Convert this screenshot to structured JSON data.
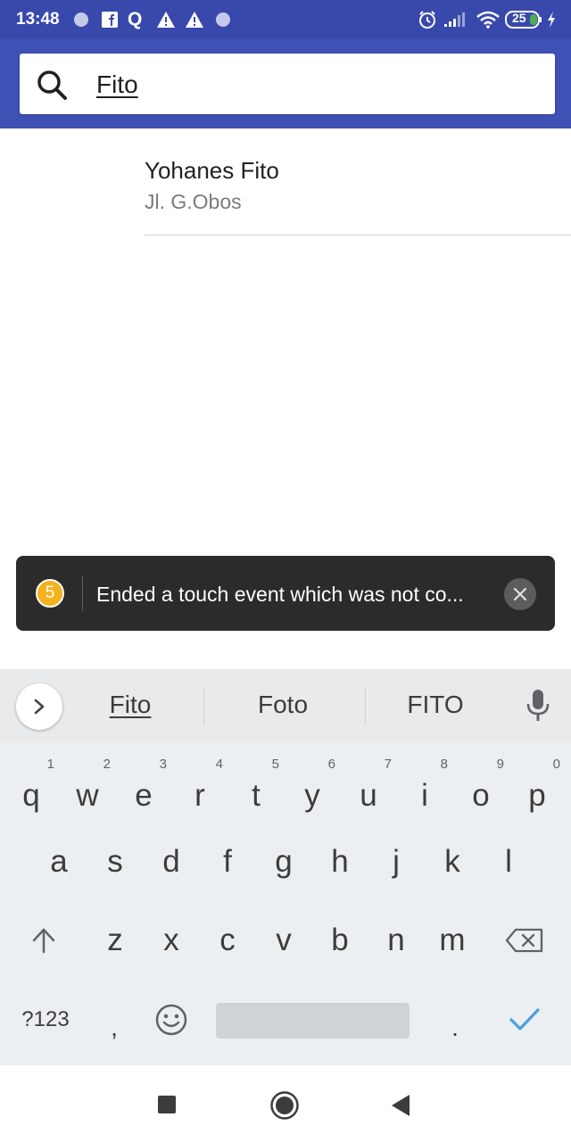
{
  "status_bar": {
    "time": "13:48",
    "battery": "25",
    "icons": [
      "dot-icon",
      "facebook-icon",
      "q-icon",
      "warning-icon",
      "warning-icon",
      "dot-icon",
      "alarm-icon",
      "signal-icon",
      "wifi-icon",
      "battery-icon",
      "charging-icon"
    ]
  },
  "search": {
    "query": "Fito",
    "icon": "search-icon"
  },
  "results": [
    {
      "name": "Yohanes Fito",
      "address": "Jl. G.Obos"
    }
  ],
  "toast": {
    "count": "5",
    "message": "Ended a touch event which was not co..."
  },
  "keyboard": {
    "suggestions": [
      "Fito",
      "Foto",
      "FITO"
    ],
    "row1": [
      "q",
      "w",
      "e",
      "r",
      "t",
      "y",
      "u",
      "i",
      "o",
      "p"
    ],
    "row1_hints": [
      "1",
      "2",
      "3",
      "4",
      "5",
      "6",
      "7",
      "8",
      "9",
      "0"
    ],
    "row2": [
      "a",
      "s",
      "d",
      "f",
      "g",
      "h",
      "j",
      "k",
      "l"
    ],
    "row3": [
      "z",
      "x",
      "c",
      "v",
      "b",
      "n",
      "m"
    ],
    "symbols_key": "?123",
    "comma_key": ",",
    "period_key": ".",
    "accent_color": "#4a9fe0"
  },
  "colors": {
    "status_bar": "#3949ab",
    "app_bar": "#3f51b5",
    "toast_badge": "#f4b21e"
  }
}
